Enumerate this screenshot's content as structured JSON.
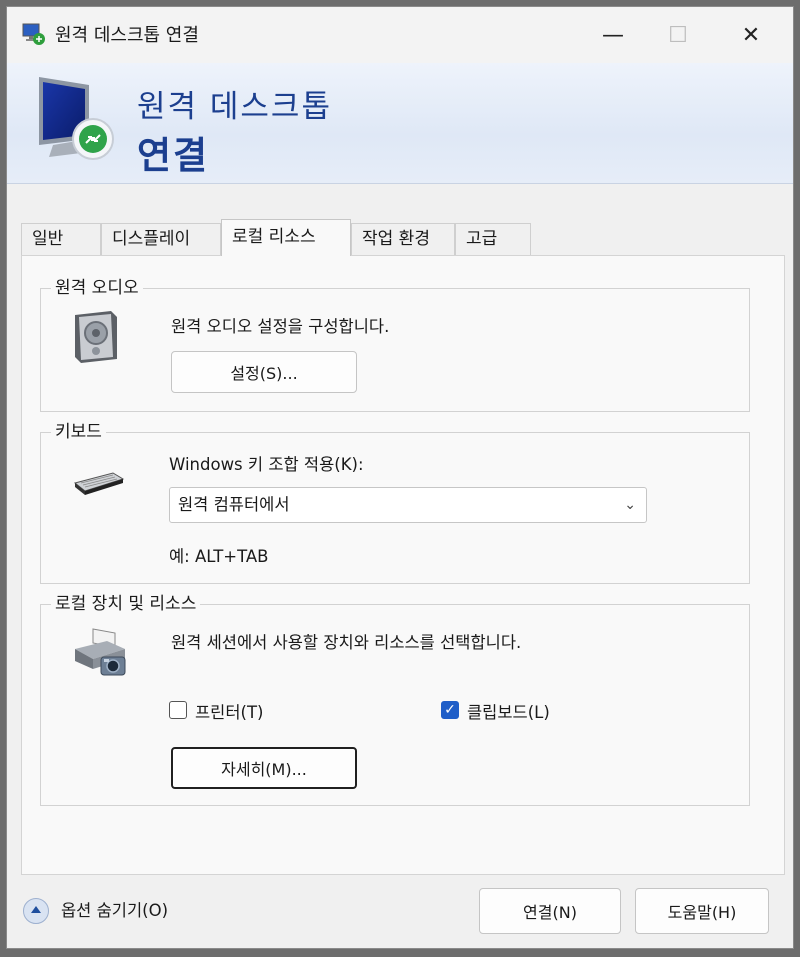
{
  "window": {
    "title": "원격 데스크톱 연결",
    "controls": {
      "minimize": "—",
      "maximize": "☐",
      "close": "✕"
    }
  },
  "banner": {
    "line1": "원격 데스크톱",
    "line2": "연결"
  },
  "tabs": [
    {
      "label": "일반",
      "active": false
    },
    {
      "label": "디스플레이",
      "active": false
    },
    {
      "label": "로컬 리소스",
      "active": true
    },
    {
      "label": "작업 환경",
      "active": false
    },
    {
      "label": "고급",
      "active": false
    }
  ],
  "remote_audio": {
    "group_title": "원격 오디오",
    "description": "원격 오디오 설정을 구성합니다.",
    "settings_button": "설정(S)..."
  },
  "keyboard": {
    "group_title": "키보드",
    "combo_label": "Windows 키 조합 적용(K):",
    "combo_value": "원격 컴퓨터에서",
    "example": "예: ALT+TAB"
  },
  "local_devices": {
    "group_title": "로컬 장치 및 리소스",
    "description": "원격 세션에서 사용할 장치와 리소스를 선택합니다.",
    "printers_label": "프린터(T)",
    "printers_checked": false,
    "clipboard_label": "클립보드(L)",
    "clipboard_checked": true,
    "more_button": "자세히(M)..."
  },
  "footer": {
    "hide_options": "옵션 숨기기(O)",
    "connect_button": "연결(N)",
    "help_button": "도움말(H)"
  },
  "colors": {
    "accent": "#1f5ec8",
    "banner_text": "#1c3f8f"
  }
}
